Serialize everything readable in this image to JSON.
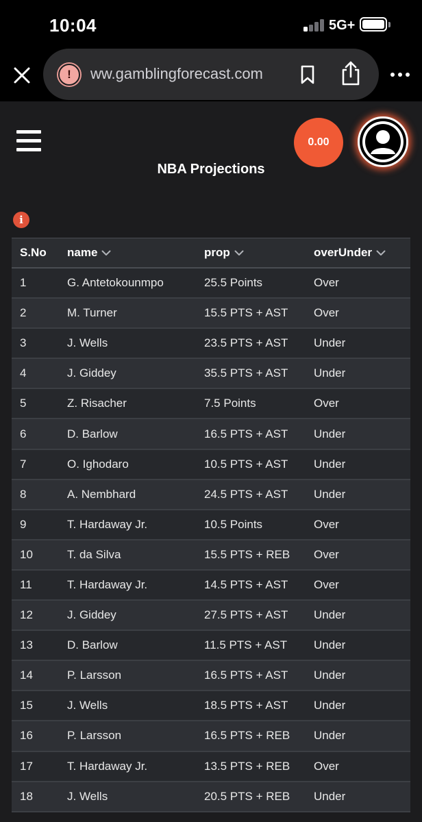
{
  "status_bar": {
    "time": "10:04",
    "network": "5G+"
  },
  "browser": {
    "url": "ww.gamblingforecast.com",
    "warning_glyph": "!",
    "icons": [
      "close-icon",
      "site-warning-icon",
      "bookmark-icon",
      "share-icon",
      "more-icon"
    ]
  },
  "header": {
    "balance": "0.00",
    "title": "NBA Projections",
    "info_glyph": "i"
  },
  "colors": {
    "accent": "#f05a35",
    "background": "#1c1c1e",
    "row_even": "#26282c",
    "row_odd": "#2e3035"
  },
  "table": {
    "columns": [
      "S.No",
      "name",
      "prop",
      "overUnder"
    ],
    "rows": [
      {
        "sno": "1",
        "name": "G. Antetokounmpo",
        "prop": "25.5 Points",
        "ou": "Over"
      },
      {
        "sno": "2",
        "name": "M. Turner",
        "prop": "15.5 PTS + AST",
        "ou": "Over"
      },
      {
        "sno": "3",
        "name": "J. Wells",
        "prop": "23.5 PTS + AST",
        "ou": "Under"
      },
      {
        "sno": "4",
        "name": "J. Giddey",
        "prop": "35.5 PTS + AST",
        "ou": "Under"
      },
      {
        "sno": "5",
        "name": "Z. Risacher",
        "prop": "7.5 Points",
        "ou": "Over"
      },
      {
        "sno": "6",
        "name": "D. Barlow",
        "prop": "16.5 PTS + AST",
        "ou": "Under"
      },
      {
        "sno": "7",
        "name": "O. Ighodaro",
        "prop": "10.5 PTS + AST",
        "ou": "Under"
      },
      {
        "sno": "8",
        "name": "A. Nembhard",
        "prop": "24.5 PTS + AST",
        "ou": "Under"
      },
      {
        "sno": "9",
        "name": "T. Hardaway Jr.",
        "prop": "10.5 Points",
        "ou": "Over"
      },
      {
        "sno": "10",
        "name": "T. da Silva",
        "prop": "15.5 PTS + REB",
        "ou": "Over"
      },
      {
        "sno": "11",
        "name": "T. Hardaway Jr.",
        "prop": "14.5 PTS + AST",
        "ou": "Over"
      },
      {
        "sno": "12",
        "name": "J. Giddey",
        "prop": "27.5 PTS + AST",
        "ou": "Under"
      },
      {
        "sno": "13",
        "name": "D. Barlow",
        "prop": "11.5 PTS + AST",
        "ou": "Under"
      },
      {
        "sno": "14",
        "name": "P. Larsson",
        "prop": "16.5 PTS + AST",
        "ou": "Under"
      },
      {
        "sno": "15",
        "name": "J. Wells",
        "prop": "18.5 PTS + AST",
        "ou": "Under"
      },
      {
        "sno": "16",
        "name": "P. Larsson",
        "prop": "16.5 PTS + REB",
        "ou": "Under"
      },
      {
        "sno": "17",
        "name": "T. Hardaway Jr.",
        "prop": "13.5 PTS + REB",
        "ou": "Over"
      },
      {
        "sno": "18",
        "name": "J. Wells",
        "prop": "20.5 PTS + REB",
        "ou": "Under"
      }
    ]
  }
}
